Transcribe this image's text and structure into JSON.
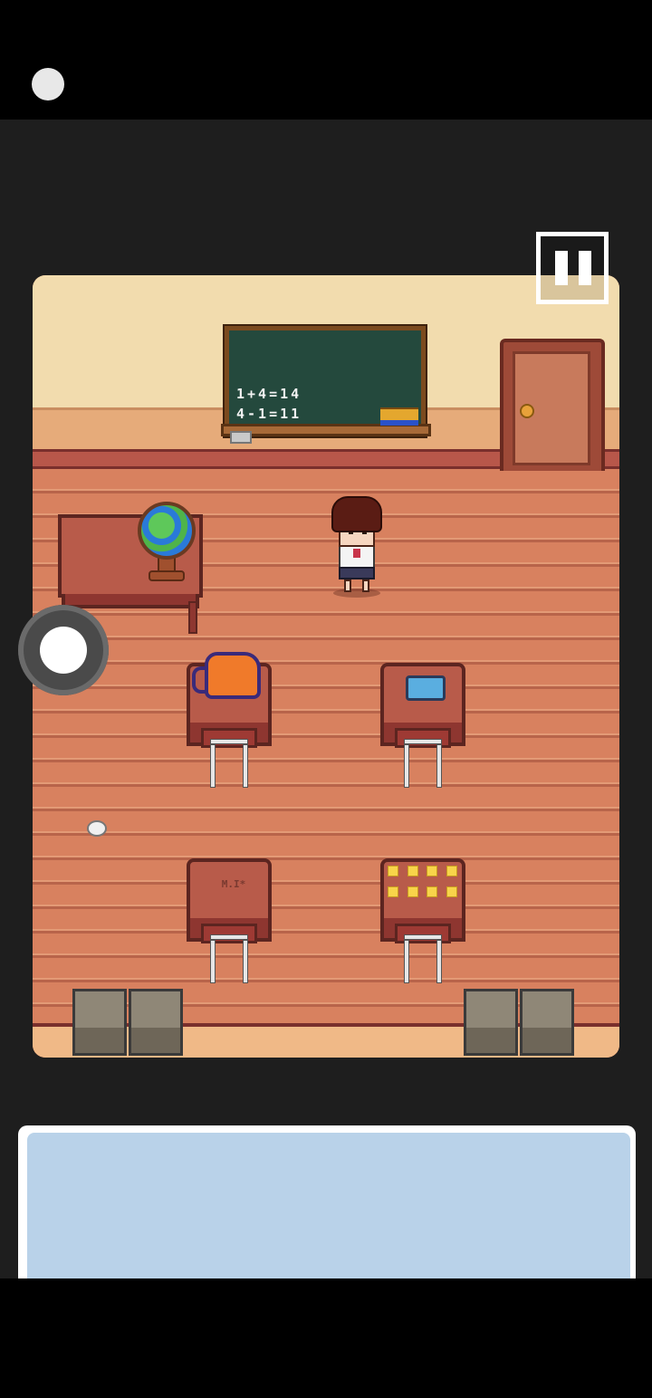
{
  "status_bar": {
    "indicator": "camera-dot"
  },
  "room": {
    "chalkboard": {
      "line_1": "1+4=14",
      "line_2": "4-1=11"
    },
    "desk_scribble": "M.I*",
    "dot_grid_count": 8
  },
  "controls": {
    "pause_icon": "pause-icon",
    "joystick_icon": "joystick-icon"
  },
  "message_box": {
    "text": ""
  },
  "colors": {
    "wall": "#f2dcae",
    "floor": "#d8815f",
    "chalkboard": "#24493d",
    "message_bg": "#b9d2e9"
  }
}
